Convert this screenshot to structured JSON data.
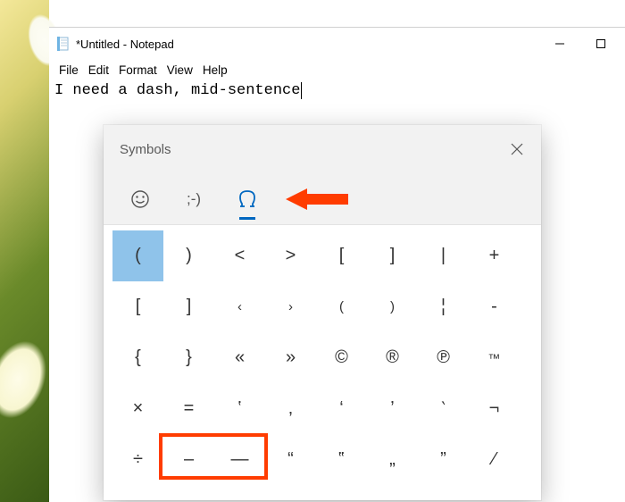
{
  "window": {
    "title": "*Untitled - Notepad"
  },
  "menus": {
    "file": "File",
    "edit": "Edit",
    "format": "Format",
    "view": "View",
    "help": "Help"
  },
  "editor": {
    "text": "I need a dash, mid-sentence"
  },
  "panel": {
    "title": "Symbols",
    "tabs": {
      "emoji_label": "emoji",
      "kaomoji_label": "kaomoji",
      "symbols_label": "symbols",
      "kaomoji_text": ";-)"
    },
    "symbols": {
      "r0": [
        "(",
        ")",
        "<",
        ">",
        "[",
        "]",
        "|",
        "+"
      ],
      "r1": [
        "[",
        "]",
        "‹",
        "›",
        "(",
        ")",
        "¦",
        "-"
      ],
      "r2": [
        "{",
        "}",
        "«",
        "»",
        "©",
        "®",
        "℗",
        "™"
      ],
      "r3": [
        "×",
        "=",
        "‛",
        "‚",
        "‘",
        "’",
        "‵",
        "¬"
      ],
      "r4": [
        "÷",
        "–",
        "—",
        "“",
        "‟",
        "„",
        "”",
        "⁄"
      ]
    }
  }
}
